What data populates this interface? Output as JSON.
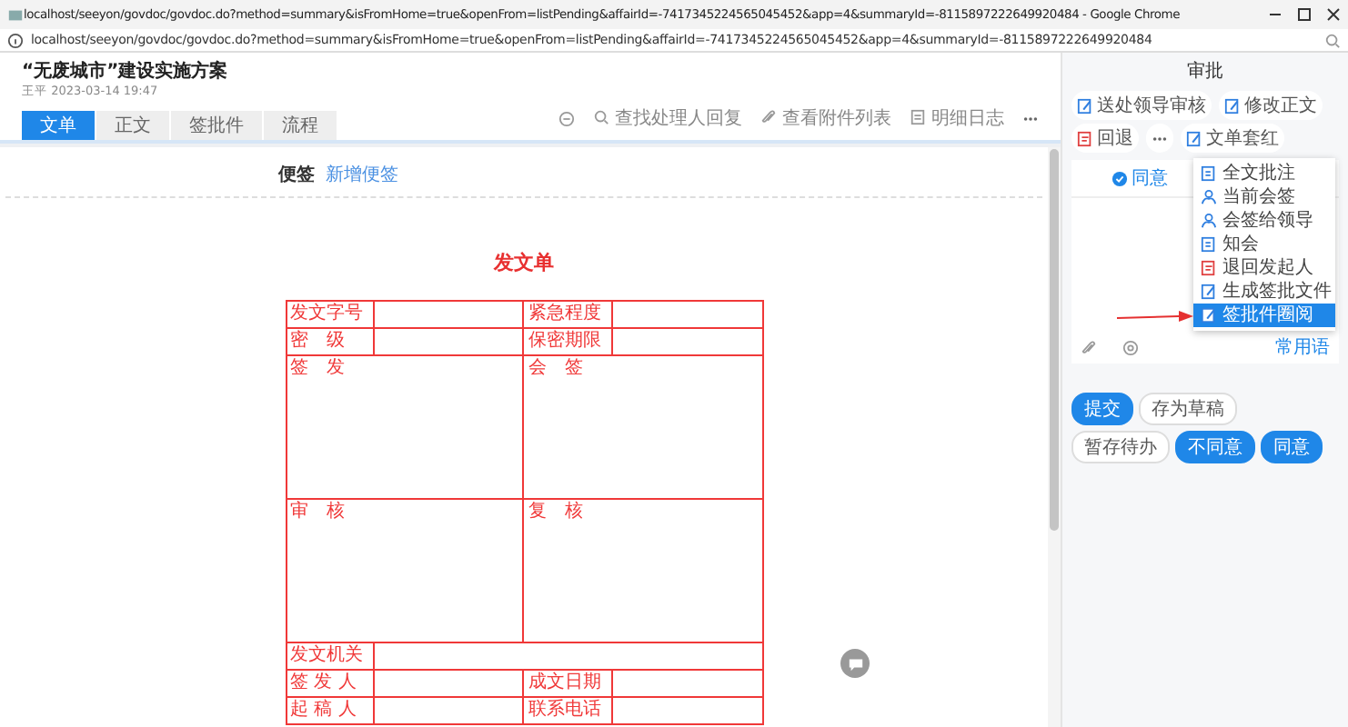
{
  "browser": {
    "title": "localhost/seeyon/govdoc/govdoc.do?method=summary&isFromHome=true&openFrom=listPending&affairId=-7417345224565045452&app=4&summaryId=-8115897222649920484 - Google Chrome",
    "url": "localhost/seeyon/govdoc/govdoc.do?method=summary&isFromHome=true&openFrom=listPending&affairId=-7417345224565045452&app=4&summaryId=-8115897222649920484"
  },
  "document": {
    "title": "“无废城市”建设实施方案",
    "meta": "王平 2023-03-14 19:47",
    "tabs": [
      {
        "label": "文单",
        "selected": true
      },
      {
        "label": "正文",
        "selected": false
      },
      {
        "label": "签批件",
        "selected": false
      },
      {
        "label": "流程",
        "selected": false
      }
    ],
    "toolbar": [
      {
        "kind": "comment"
      },
      {
        "kind": "search",
        "label": "查找处理人回复"
      },
      {
        "kind": "attachment",
        "label": "查看附件列表"
      },
      {
        "kind": "log",
        "label": "明细日志"
      },
      {
        "kind": "more"
      }
    ],
    "note": {
      "title": "便签",
      "link": "新增便签"
    },
    "form": {
      "title": "发文单",
      "rows": [
        {
          "kind": "pair",
          "label": "发文字号",
          "label_2": "紧急程度"
        },
        {
          "kind": "pair",
          "label": "密　级",
          "label_2": "保密期限"
        },
        {
          "kind": "opinion",
          "label": "签　发",
          "label_2": "会　签"
        },
        {
          "kind": "opinion",
          "label": "审　核",
          "label_2": "复　核"
        },
        {
          "kind": "wide",
          "label": "发文机关"
        },
        {
          "kind": "pair",
          "label": "签 发 人",
          "label_2": "成文日期"
        },
        {
          "kind": "pair",
          "label": "起 稿 人",
          "label_2": "联系电话"
        }
      ]
    }
  },
  "approval": {
    "title": "审批",
    "actions": [
      {
        "label": "送处领导审核",
        "kind": "edit"
      },
      {
        "label": "修改正文",
        "kind": "edit"
      },
      {
        "label": "回退",
        "kind": "return"
      },
      {
        "kind": "more"
      },
      {
        "label": "文单套红",
        "kind": "edit"
      }
    ],
    "menu": [
      {
        "label": "全文批注",
        "kind": "doc",
        "selected": false
      },
      {
        "label": "当前会签",
        "kind": "people",
        "selected": false
      },
      {
        "label": "会签给领导",
        "kind": "people",
        "selected": false
      },
      {
        "label": "知会",
        "kind": "doc",
        "selected": false
      },
      {
        "label": "退回发起人",
        "kind": "return",
        "selected": false
      },
      {
        "label": "生成签批文件",
        "kind": "edit",
        "selected": false
      },
      {
        "label": "签批件圈阅",
        "kind": "edit",
        "selected": true
      }
    ],
    "opinion": {
      "tab": "同意",
      "link": "常用语"
    },
    "buttons": [
      {
        "label": "提交",
        "primary": true
      },
      {
        "label": "存为草稿",
        "primary": false
      },
      {
        "label": "暂存待办",
        "primary": false
      },
      {
        "label": "不同意",
        "primary": true
      },
      {
        "label": "同意",
        "primary": true
      }
    ]
  }
}
